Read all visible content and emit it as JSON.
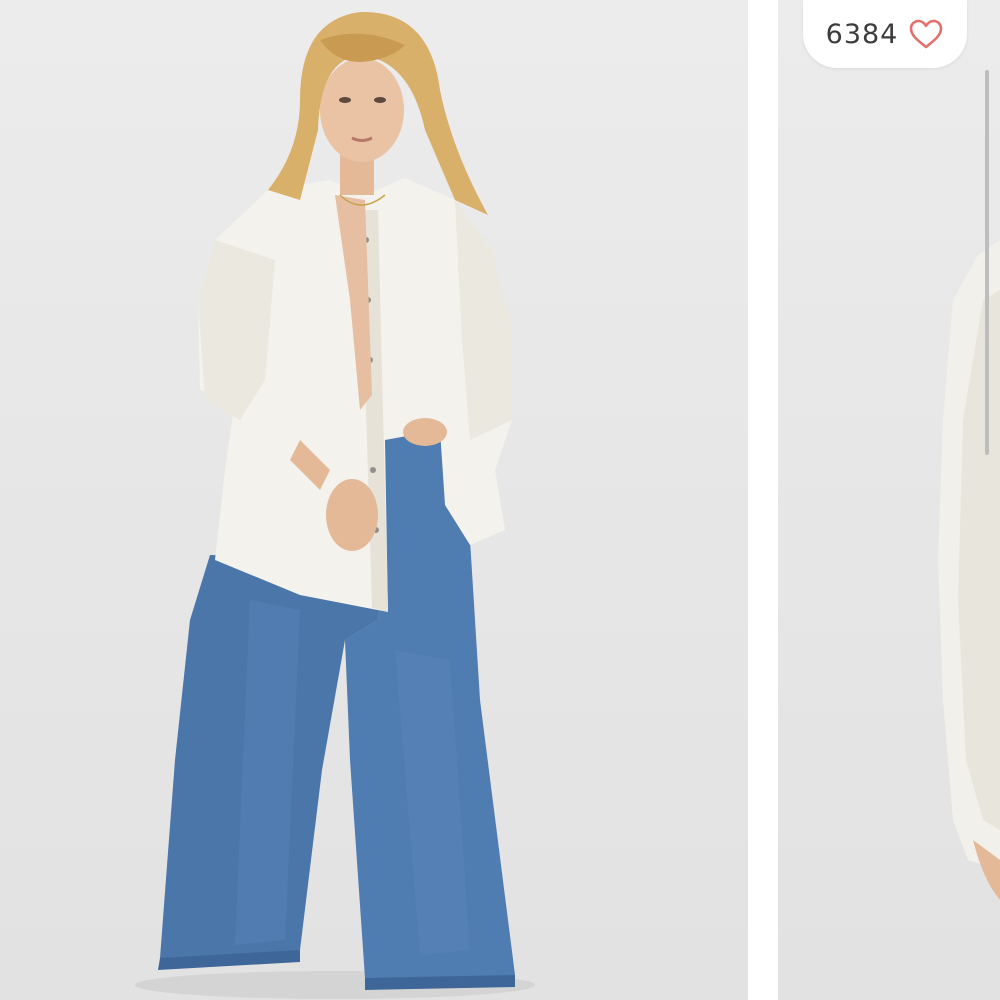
{
  "gallery": {
    "likes": {
      "count": "6384",
      "icon": "heart-outline-icon",
      "icon_color": "#e2706b"
    },
    "slides": [
      {
        "index": 1,
        "subject": "model-full-length"
      },
      {
        "index": 2,
        "subject": "model-sleeve-detail"
      }
    ],
    "colors": {
      "backdrop": "#e8e8e8",
      "shirt": "#f4f2ec",
      "denim": "#4a76aa",
      "hair": "#d9b06a"
    }
  }
}
